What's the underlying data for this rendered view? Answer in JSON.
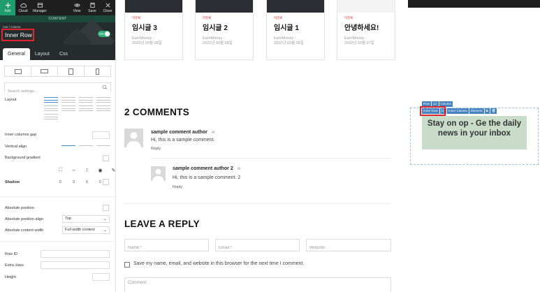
{
  "toolbar": {
    "add": "Add",
    "cloud": "Cloud",
    "manager": "Manager",
    "view": "View",
    "save": "Save",
    "close": "Close"
  },
  "panel": {
    "section": "CONTENT",
    "breadcrumb": "row  /  column",
    "element_title": "Inner Row",
    "toggle": "ON",
    "tabs": [
      "General",
      "Layout",
      "Css"
    ],
    "search_placeholder": "Search settings...",
    "labels": {
      "layout": "Layout",
      "inner_gap": "Inner columns gap",
      "vertical_align": "Vertical align",
      "background_gradient": "Background gradient",
      "shadow": "Shadow",
      "absolute_position": "Absolute position",
      "absolute_position_align": "Absolute position align",
      "absolute_content_width": "Absolute content width",
      "row_id": "Row ID",
      "extra_class": "Extra class",
      "height": "Height"
    },
    "shadow_values": [
      "0",
      "0",
      "6",
      "0"
    ],
    "absolute_position_align_value": "Top",
    "absolute_content_width_value": "Full width content"
  },
  "cards": [
    {
      "category": "미분류",
      "title": "임시글 3",
      "author": "EarnMoney -",
      "date": "2022년 03월 08일"
    },
    {
      "category": "미분류",
      "title": "임시글 2",
      "author": "EarnMoney -",
      "date": "2022년 03월 08일"
    },
    {
      "category": "미분류",
      "title": "임시글 1",
      "author": "EarnMoney -",
      "date": "2022년 03월 08일"
    },
    {
      "category": "미분류",
      "title": "안녕하세요!",
      "author": "EarnMoney -",
      "date": "2022년 03월 07일"
    }
  ],
  "comments": {
    "title": "2 COMMENTS",
    "items": [
      {
        "author": "sample comment author",
        "at": "At",
        "text": "Hi, this is a sample comment.",
        "reply": "Reply"
      },
      {
        "author": "sample comment author 2",
        "at": "At",
        "text": "Hi, this is a sample comment. 2",
        "reply": "Reply"
      }
    ]
  },
  "reply_form": {
    "title": "LEAVE A REPLY",
    "name_placeholder": "Name:*",
    "email_placeholder": "Email:*",
    "website_placeholder": "Website:",
    "save_label": "Save my name, email, and website in this browser for the next time I comment.",
    "comment_placeholder": "Comment:"
  },
  "widget": {
    "badges_top": [
      "Row",
      "(1)",
      "Column"
    ],
    "badges_bottom": [
      "Inner Row",
      "(1)",
      "Inner Column",
      "Element"
    ],
    "newsletter_text": "Stay on op - Ge the daily news in your inbox"
  },
  "colors": {
    "accent_green": "#1f9d6e",
    "highlight_red": "#e0252c",
    "badge_blue": "#4583c0",
    "newsletter_bg": "#c8dcc9"
  }
}
